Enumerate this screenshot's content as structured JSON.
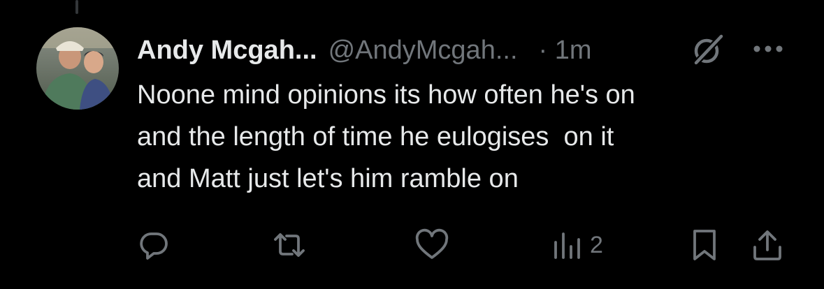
{
  "tweet": {
    "display_name": "Andy Mcgah...",
    "handle": "@AndyMcgah...",
    "separator": "·",
    "time": "1m",
    "text": "Noone mind opinions its how often he's on\nand the length of time he eulogises  on it\nand Matt just let's him ramble on"
  },
  "actions": {
    "reply_count": "",
    "retweet_count": "",
    "like_count": "",
    "views_count": "2"
  },
  "colors": {
    "background": "#000000",
    "primary_text": "#e7e9ea",
    "secondary_text": "#71767b",
    "thread_line": "#333639"
  },
  "icons": {
    "grok": "grok-icon",
    "more": "more-icon",
    "reply": "reply-icon",
    "retweet": "retweet-icon",
    "like": "like-icon",
    "views": "views-icon",
    "bookmark": "bookmark-icon",
    "share": "share-icon"
  }
}
